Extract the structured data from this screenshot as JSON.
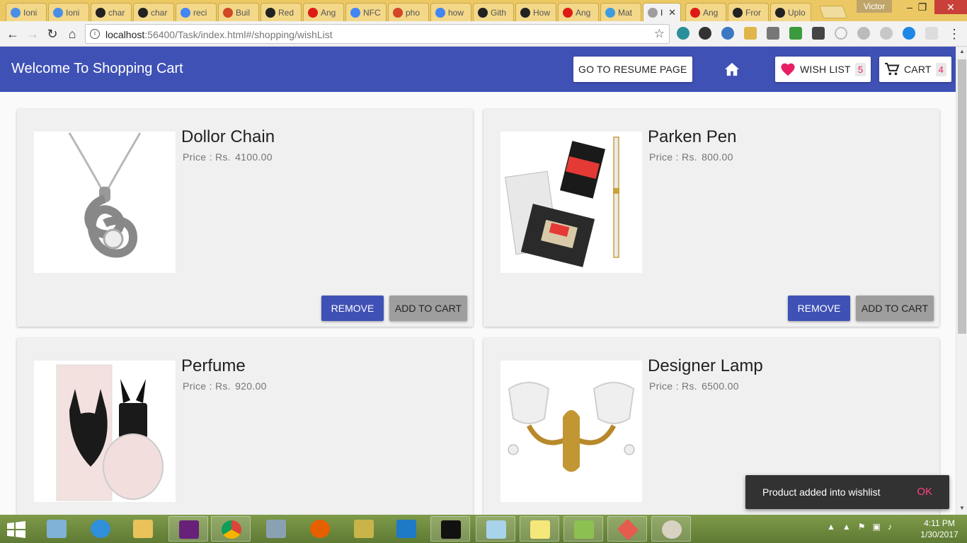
{
  "browser": {
    "tabs": [
      {
        "label": "Ioni",
        "icon": "ionic-icon",
        "color": "#4a8fe7"
      },
      {
        "label": "Ioni",
        "icon": "ionic-icon",
        "color": "#4a8fe7"
      },
      {
        "label": "char",
        "icon": "github-icon",
        "color": "#222222"
      },
      {
        "label": "char",
        "icon": "github-icon",
        "color": "#222222"
      },
      {
        "label": "reci",
        "icon": "google-icon",
        "color": "#4285f4"
      },
      {
        "label": "Buil",
        "icon": "office-icon",
        "color": "#d24726"
      },
      {
        "label": "Red",
        "icon": "github-icon",
        "color": "#222222"
      },
      {
        "label": "Ang",
        "icon": "angular-icon",
        "color": "#dd1b16"
      },
      {
        "label": "NFC",
        "icon": "google-icon",
        "color": "#4285f4"
      },
      {
        "label": "pho",
        "icon": "office-icon",
        "color": "#d24726"
      },
      {
        "label": "how",
        "icon": "google-icon",
        "color": "#4285f4"
      },
      {
        "label": "Gith",
        "icon": "github-icon",
        "color": "#222222"
      },
      {
        "label": "How",
        "icon": "github-icon",
        "color": "#222222"
      },
      {
        "label": "Ang",
        "icon": "angular-icon",
        "color": "#dd1b16"
      },
      {
        "label": "Mat",
        "icon": "material-icon",
        "color": "#3f9be0"
      },
      {
        "label": "I",
        "icon": "page-icon",
        "color": "#9e9e9e"
      },
      {
        "label": "Ang",
        "icon": "angular-icon",
        "color": "#dd1b16"
      },
      {
        "label": "Fror",
        "icon": "github-icon",
        "color": "#222222"
      },
      {
        "label": "Uplo",
        "icon": "github-icon",
        "color": "#222222"
      }
    ],
    "user": "Victor",
    "url_host": "localhost",
    "url_rest": ":56400/Task/index.html#/shopping/wishList"
  },
  "header": {
    "title": "Welcome To Shopping Cart",
    "resume_label": "GO TO RESUME PAGE",
    "wishlist_label": "WISH LIST",
    "wishlist_count": "5",
    "cart_label": "CART",
    "cart_count": "4"
  },
  "products": [
    {
      "name": "Dollor Chain",
      "price_label": "Price : Rs.",
      "price": "4100.00",
      "remove_label": "REMOVE",
      "add_label": "ADD TO CART"
    },
    {
      "name": "Parken Pen",
      "price_label": "Price : Rs.",
      "price": "800.00",
      "remove_label": "REMOVE",
      "add_label": "ADD TO CART"
    },
    {
      "name": "Perfume",
      "price_label": "Price : Rs.",
      "price": "920.00"
    },
    {
      "name": "Designer Lamp",
      "price_label": "Price : Rs.",
      "price": "6500.00"
    }
  ],
  "snackbar": {
    "message": "Product added into wishlist",
    "action": "OK"
  },
  "taskbar": {
    "time": "4:11 PM",
    "date": "1/30/2017"
  },
  "colors": {
    "primary": "#3f51b5",
    "accent": "#e91e63",
    "snack_action": "#ff4081"
  }
}
